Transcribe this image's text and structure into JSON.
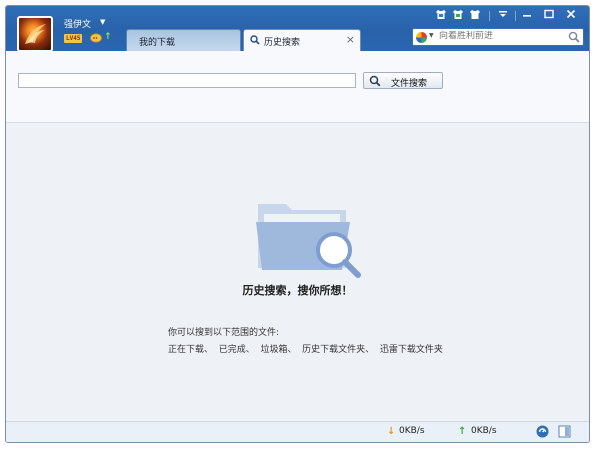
{
  "user": {
    "name": "强伊文",
    "level": "LV45"
  },
  "tabs": [
    {
      "label": "我的下载"
    },
    {
      "label": "历史搜索",
      "close": "×"
    }
  ],
  "top_search": {
    "placeholder": "向着胜利前进"
  },
  "search": {
    "input_value": "",
    "button_label": "文件搜索"
  },
  "empty_state": {
    "title": "历史搜索，搜你所想！",
    "description": "你可以搜到以下范围的文件:",
    "scopes": "正在下载、  已完成、  垃圾箱、  历史下载文件夹、  迅雷下载文件夹"
  },
  "status": {
    "download_speed": "0KB/s",
    "upload_speed": "0KB/s"
  },
  "colors": {
    "titlebar": "#2862ab",
    "accent": "#3a7bd5",
    "download_arrow": "#e59a1c",
    "upload_arrow": "#3aa83a"
  }
}
